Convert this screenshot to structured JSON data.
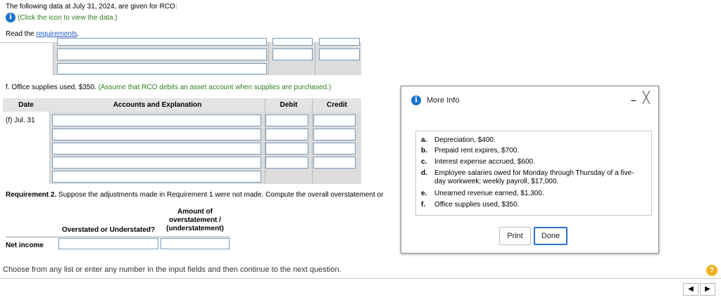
{
  "intro": {
    "text": "The following data at July 31, 2024, are given for RCO:",
    "info_hint": "(Click the icon to view the data.)",
    "read_prefix": "Read the ",
    "read_link": "requirements",
    "read_suffix": "."
  },
  "section_f": {
    "label": "f.",
    "text": "Office supplies used, $350.",
    "note": "(Assume that RCO debits an asset account when supplies are purchased.)"
  },
  "journal": {
    "headers": {
      "date": "Date",
      "accounts": "Accounts and Explanation",
      "debit": "Debit",
      "credit": "Credit"
    },
    "date_value": "(f) Jul. 31"
  },
  "requirement2": {
    "label": "Requirement 2.",
    "text": "Suppose the adjustments made in Requirement 1 were not made. Compute the overall overstatement or",
    "col1_header": "Overstated or Understated?",
    "col2_header_l1": "Amount of",
    "col2_header_l2": "overstatement /",
    "col2_header_l3": "(understatement)",
    "row_label": "Net income"
  },
  "footer": {
    "instruction": "Choose from any list or enter any number in the input fields and then continue to the next question.",
    "help": "?",
    "prev": "◀",
    "next": "▶"
  },
  "modal": {
    "title": "More Info",
    "minimize": "–",
    "close": "╳",
    "items": [
      {
        "letter": "a.",
        "text": "Depreciation, $400."
      },
      {
        "letter": "b.",
        "text": "Prepaid rent expires, $700."
      },
      {
        "letter": "c.",
        "text": "Interest expense accrued, $600."
      },
      {
        "letter": "d.",
        "text": "Employee salaries owed for Monday through Thursday of a five-day workweek; weekly payroll, $17,000."
      },
      {
        "letter": "e.",
        "text": "Unearned revenue earned, $1,300."
      },
      {
        "letter": "f.",
        "text": "Office supplies used, $350."
      }
    ],
    "print_label": "Print",
    "done_label": "Done"
  },
  "colors": {
    "link": "#1f58c8",
    "hint": "#2e7d1f",
    "info_icon": "#1a73c9",
    "help_icon": "#f2b01e",
    "done_border": "#2c6fd1"
  }
}
